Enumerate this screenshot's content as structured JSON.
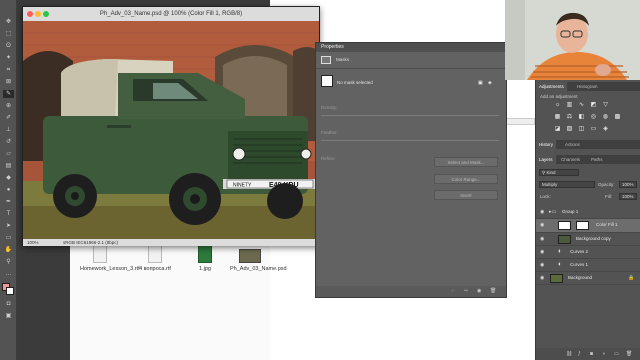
{
  "document": {
    "title": "Ph_Adv_03_Name.psd @ 100% (Color Fill 1, RGB/8)",
    "zoom": "100%",
    "profile": "sRGB IEC61966-2.1 (8bpc)",
    "plate_left": "NINETY",
    "plate_right": "E40 KDU"
  },
  "finder": {
    "files": [
      {
        "name": "Homework_Lesson_3.rtf",
        "kind": "rtf"
      },
      {
        "name": "4 вопроса.rtf",
        "kind": "rtf"
      },
      {
        "name": "1.jpg",
        "kind": "jpg"
      },
      {
        "name": "Ph_Adv_03_Name.psd",
        "kind": "psd"
      }
    ]
  },
  "properties": {
    "title": "Properties",
    "section": "Masks",
    "status": "No mask selected",
    "density_label": "Density:",
    "feather_label": "Feather:",
    "refine_label": "Refine:",
    "select_mask_btn": "Select and Mask...",
    "color_range_btn": "Color Range...",
    "invert_btn": "Invert"
  },
  "adjustments": {
    "tabs": [
      "Adjustments",
      "Histogram"
    ],
    "add_label": "Add an adjustment"
  },
  "history_tabs": [
    "History",
    "Actions"
  ],
  "layers_panel": {
    "tabs": [
      "Layers",
      "Channels",
      "Paths"
    ],
    "kind_filter": "Kind",
    "blend_mode": "Multiply",
    "opacity_label": "Opacity:",
    "opacity_value": "100%",
    "lock_label": "Lock:",
    "fill_label": "Fill:",
    "fill_value": "100%",
    "layers": [
      {
        "name": "Group 1",
        "type": "group"
      },
      {
        "name": "Color Fill 1",
        "type": "fill",
        "selected": true
      },
      {
        "name": "Background copy",
        "type": "image"
      },
      {
        "name": "Curves 2",
        "type": "adjustment"
      },
      {
        "name": "Curves 1",
        "type": "adjustment"
      },
      {
        "name": "Background",
        "type": "image"
      }
    ]
  },
  "colors": {
    "ps_panel": "#535353",
    "ps_dark": "#3a3a3a",
    "selected_layer": "#6d6d6d",
    "traffic_red": "#fc5f57",
    "traffic_yellow": "#fdbc2e",
    "traffic_green": "#29c840",
    "truck_green": "#3d5a3b",
    "shirt_orange": "#e8843a"
  },
  "icons": [
    "move-icon",
    "marquee-icon",
    "lasso-icon",
    "crop-icon",
    "eyedropper-icon",
    "brush-icon",
    "eraser-icon",
    "gradient-icon",
    "pen-icon",
    "type-icon",
    "hand-icon",
    "zoom-icon",
    "eye-icon",
    "folder-icon",
    "curves-icon",
    "fill-icon"
  ]
}
